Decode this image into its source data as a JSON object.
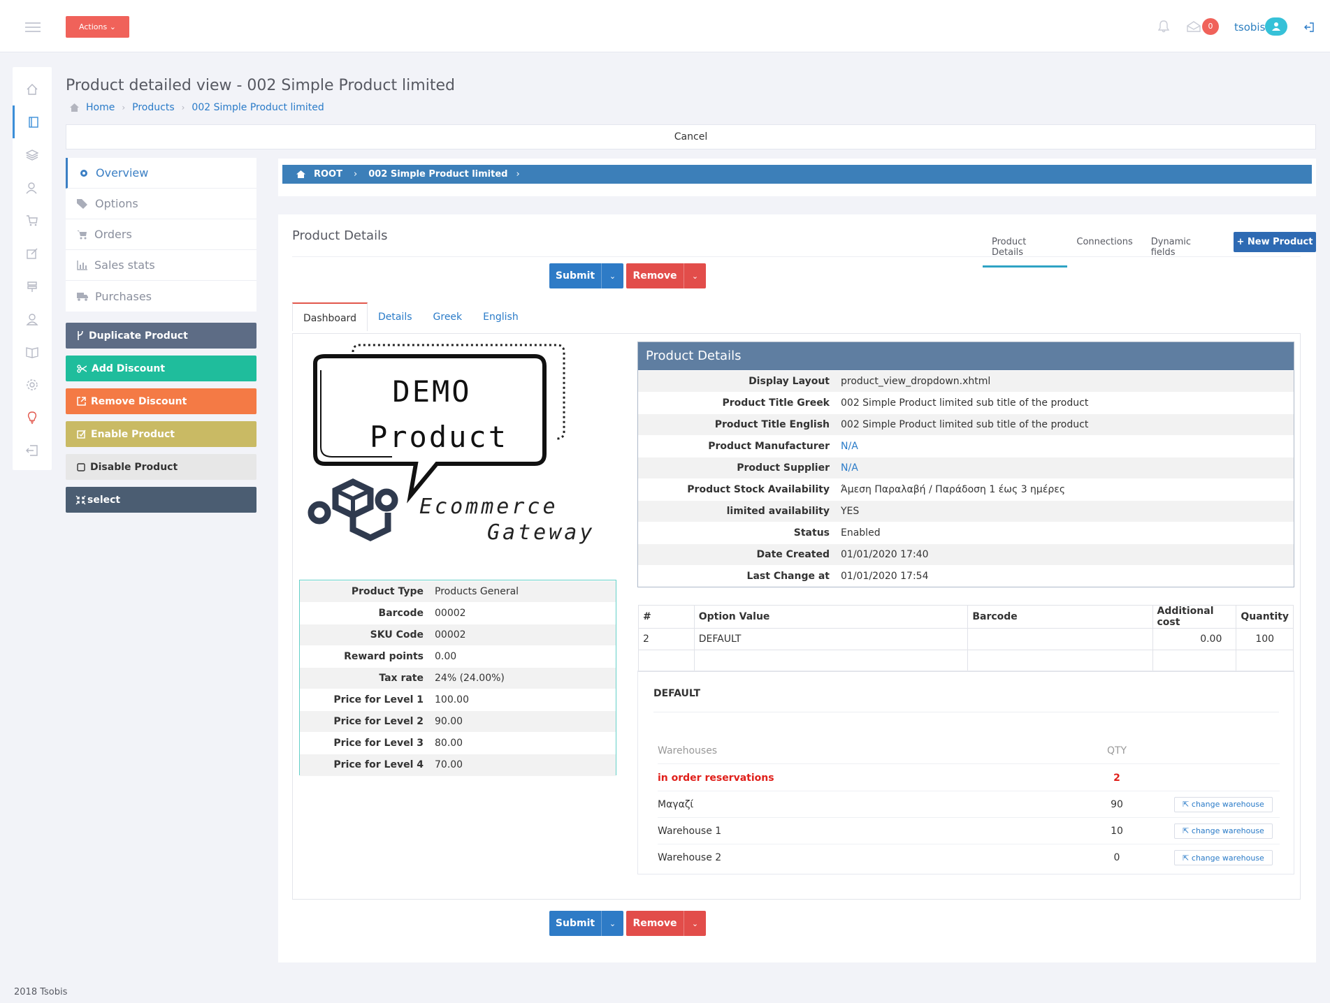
{
  "header": {
    "actions_label": "Actions",
    "mail_badge": "0",
    "username": "tsobis"
  },
  "page": {
    "title": "Product detailed view - 002 Simple Product limited",
    "breadcrumb": [
      "Home",
      "Products",
      "002 Simple Product limited"
    ],
    "cancel_label": "Cancel"
  },
  "side_menu": [
    {
      "label": "Overview",
      "icon": "gear-icon"
    },
    {
      "label": "Options",
      "icon": "tags-icon"
    },
    {
      "label": "Orders",
      "icon": "cart-icon"
    },
    {
      "label": "Sales stats",
      "icon": "bar-chart-icon"
    },
    {
      "label": "Purchases",
      "icon": "truck-icon"
    }
  ],
  "action_buttons": [
    {
      "label": "Duplicate Product",
      "color": "#5d6c85"
    },
    {
      "label": "Add Discount",
      "color": "#1fbd9c"
    },
    {
      "label": "Remove Discount",
      "color": "#f47a45"
    },
    {
      "label": "Enable Product",
      "color": "#c9ba64"
    },
    {
      "label": "Disable Product",
      "color": "#e7e7e7"
    },
    {
      "label": "select",
      "color": "#4b5d72"
    }
  ],
  "root_path": [
    "ROOT",
    "002 Simple Product limited"
  ],
  "panel": {
    "title": "Product Details",
    "tabs": [
      "Product Details",
      "Connections",
      "Dynamic fields"
    ],
    "new_product_label": "New Product",
    "submit_label": "Submit",
    "remove_label": "Remove",
    "inner_tabs": [
      "Dashboard",
      "Details",
      "Greek",
      "English"
    ]
  },
  "demo_image": {
    "line1": "DEMO",
    "line2": "Product",
    "brand1": "Ecommerce",
    "brand2": "Gateway"
  },
  "product_info": [
    {
      "key": "Product Type",
      "value": "Products General"
    },
    {
      "key": "Barcode",
      "value": "00002"
    },
    {
      "key": "SKU Code",
      "value": "00002"
    },
    {
      "key": "Reward points",
      "value": "0.00"
    },
    {
      "key": "Tax rate",
      "value": "24% (24.00%)"
    },
    {
      "key": "Price for Level 1",
      "value": "100.00"
    },
    {
      "key": "Price for Level 2",
      "value": "90.00"
    },
    {
      "key": "Price for Level 3",
      "value": "80.00"
    },
    {
      "key": "Price for Level 4",
      "value": "70.00"
    }
  ],
  "product_details": {
    "header": "Product Details",
    "rows": [
      {
        "key": "Display Layout",
        "value": "product_view_dropdown.xhtml"
      },
      {
        "key": "Product Title Greek",
        "value": "002 Simple Product limited sub title of the product"
      },
      {
        "key": "Product Title English",
        "value": "002 Simple Product limited sub title of the product"
      },
      {
        "key": "Product Manufacturer",
        "value": "N/A"
      },
      {
        "key": "Product Supplier",
        "value": "N/A"
      },
      {
        "key": "Product Stock Availability",
        "value": "Άμεση Παραλαβή / Παράδοση 1 έως 3 ημέρες"
      },
      {
        "key": "limited availability",
        "value": "YES"
      },
      {
        "key": "Status",
        "value": "Enabled"
      },
      {
        "key": "Date Created",
        "value": "01/01/2020 17:40"
      },
      {
        "key": "Last Change at",
        "value": "01/01/2020 17:54"
      }
    ]
  },
  "options_table": {
    "headers": [
      "#",
      "Option Value",
      "Barcode",
      "Additional cost",
      "Quantity"
    ],
    "rows": [
      [
        "2",
        "DEFAULT",
        "",
        "0.00",
        "100"
      ]
    ]
  },
  "warehouses": {
    "title": "DEFAULT",
    "col_name": "Warehouses",
    "col_qty": "QTY",
    "reservations_label": "in order reservations",
    "reservations_qty": "2",
    "change_label": "change warehouse",
    "rows": [
      {
        "name": "Μαγαζί",
        "qty": "90"
      },
      {
        "name": "Warehouse 1",
        "qty": "10"
      },
      {
        "name": "Warehouse 2",
        "qty": "0"
      }
    ]
  },
  "footer": "2018 Tsobis"
}
